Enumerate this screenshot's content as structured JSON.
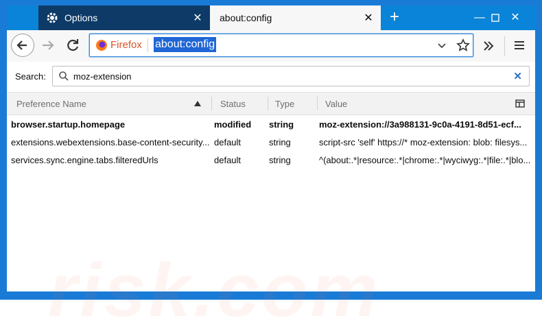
{
  "tabs": [
    {
      "label": "Options",
      "icon": "gear-icon",
      "active": false
    },
    {
      "label": "about:config",
      "active": true
    }
  ],
  "navbar": {
    "identity_label": "Firefox",
    "url": "about:config"
  },
  "search": {
    "label": "Search:",
    "value": "moz-extension"
  },
  "table": {
    "columns": [
      "Preference Name",
      "Status",
      "Type",
      "Value"
    ],
    "rows": [
      {
        "name": "browser.startup.homepage",
        "status": "modified",
        "type": "string",
        "value": "moz-extension://3a988131-9c0a-4191-8d51-ecf...",
        "bold": true
      },
      {
        "name": "extensions.webextensions.base-content-security...",
        "status": "default",
        "type": "string",
        "value": "script-src 'self' https://* moz-extension: blob: filesys...",
        "bold": false
      },
      {
        "name": "services.sync.engine.tabs.filteredUrls",
        "status": "default",
        "type": "string",
        "value": "^(about:.*|resource:.*|chrome:.*|wyciwyg:.*|file:.*|blo...",
        "bold": false
      }
    ]
  },
  "watermark": "risk.com",
  "colors": {
    "frame": "#1a7bd6",
    "active_tab": "#f7f7f7",
    "inactive_tab": "#0d3a66",
    "selection": "#1f66d6"
  }
}
